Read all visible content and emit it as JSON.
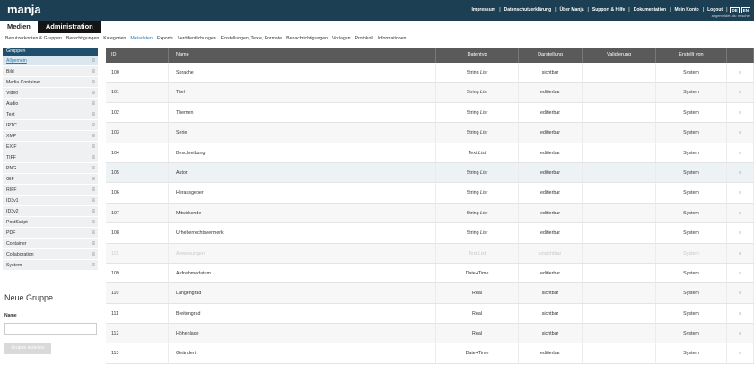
{
  "brand": {
    "logo_text": "manja"
  },
  "topnav": {
    "items": [
      "Impressum",
      "Datenschutzerklärung",
      "Über Manja",
      "Support & Hilfe",
      "Dokumentation",
      "Mein Konto",
      "Logout"
    ],
    "lang_de": "DE",
    "lang_en": "EN",
    "logged_in_as": "angemeldet als: m.schef"
  },
  "main_tabs": [
    "Medien",
    "Administration"
  ],
  "subnav": [
    "Benutzerkonten & Gruppen",
    "Berechtigungen",
    "Kategorien",
    "Metadaten",
    "Exporte",
    "Veröffentlichungen",
    "Einstellungen, Texte, Formate",
    "Benachrichtigungen",
    "Vorlagen",
    "Protokoll",
    "Informationen"
  ],
  "sidebar": {
    "header": "Gruppen",
    "items": [
      "Allgemein",
      "Bild",
      "Media Container",
      "Video",
      "Audio",
      "Text",
      "IPTC",
      "XMP",
      "EXIF",
      "TIFF",
      "PNG",
      "GIF",
      "RIFF",
      "ID3v1",
      "ID3v2",
      "PostScript",
      "PDF",
      "Container",
      "Collaboration",
      "System"
    ],
    "drag_glyph": "≡"
  },
  "new_group": {
    "title": "Neue Gruppe",
    "name_label": "Name",
    "name_value": "",
    "button": "Gruppe erstellen"
  },
  "table": {
    "headers": {
      "id": "ID",
      "name": "Name",
      "typ": "Datentyp",
      "dar": "Darstellung",
      "val": "Validierung",
      "by": "Erstellt von",
      "act": ""
    },
    "action_glyph": "≡",
    "rows": [
      {
        "id": "100",
        "name": "Sprache",
        "typ": "String List",
        "dar": "sichtbar",
        "val": "",
        "by": "System"
      },
      {
        "id": "101",
        "name": "Titel",
        "typ": "String List",
        "dar": "editierbar",
        "val": "",
        "by": "System"
      },
      {
        "id": "102",
        "name": "Themen",
        "typ": "String List",
        "dar": "editierbar",
        "val": "",
        "by": "System"
      },
      {
        "id": "103",
        "name": "Serie",
        "typ": "String List",
        "dar": "editierbar",
        "val": "",
        "by": "System"
      },
      {
        "id": "104",
        "name": "Beschreibung",
        "typ": "Text List",
        "dar": "editierbar",
        "val": "",
        "by": "System"
      },
      {
        "id": "105",
        "name": "Autor",
        "typ": "String List",
        "dar": "editierbar",
        "val": "",
        "by": "System"
      },
      {
        "id": "106",
        "name": "Herausgeber",
        "typ": "String List",
        "dar": "editierbar",
        "val": "",
        "by": "System"
      },
      {
        "id": "107",
        "name": "Mitwirkende",
        "typ": "String List",
        "dar": "editierbar",
        "val": "",
        "by": "System"
      },
      {
        "id": "108",
        "name": "Urheberrechtsvermerk",
        "typ": "String List",
        "dar": "editierbar",
        "val": "",
        "by": "System"
      },
      {
        "id": "115",
        "name": "Anweisungen",
        "typ": "Text List",
        "dar": "unsichtbar",
        "val": "",
        "by": "System"
      },
      {
        "id": "109",
        "name": "Aufnahmedatum",
        "typ": "Date+Time",
        "dar": "editierbar",
        "val": "",
        "by": "System"
      },
      {
        "id": "110",
        "name": "Längengrad",
        "typ": "Real",
        "dar": "sichtbar",
        "val": "",
        "by": "System"
      },
      {
        "id": "111",
        "name": "Breitengrad",
        "typ": "Real",
        "dar": "sichtbar",
        "val": "",
        "by": "System"
      },
      {
        "id": "112",
        "name": "Höhenlage",
        "typ": "Real",
        "dar": "sichtbar",
        "val": "",
        "by": "System"
      },
      {
        "id": "113",
        "name": "Geändert",
        "typ": "Date+Time",
        "dar": "editierbar",
        "val": "",
        "by": "System"
      }
    ]
  },
  "colors": {
    "topbar": "#1d3f54",
    "sidebar_header": "#1f4f6d",
    "table_header": "#5a5a5a",
    "link_active": "#2a79b6"
  }
}
